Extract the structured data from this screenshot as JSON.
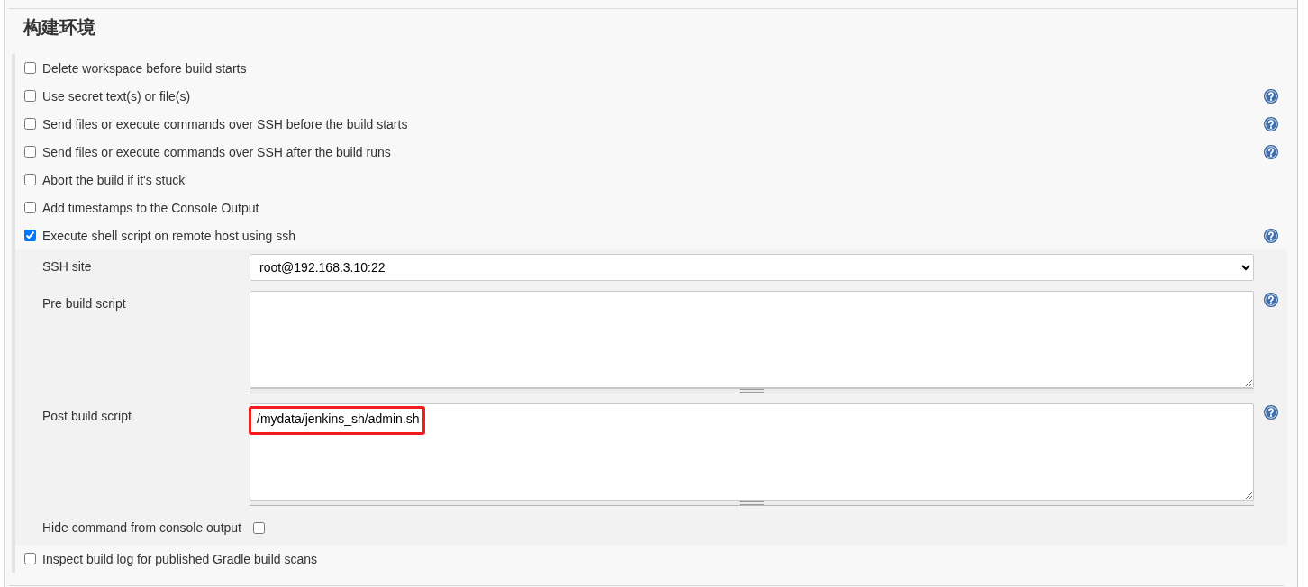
{
  "section": {
    "title": "构建环境"
  },
  "options": [
    {
      "label": "Delete workspace before build starts",
      "checked": false,
      "help": false
    },
    {
      "label": "Use secret text(s) or file(s)",
      "checked": false,
      "help": true
    },
    {
      "label": "Send files or execute commands over SSH before the build starts",
      "checked": false,
      "help": true
    },
    {
      "label": "Send files or execute commands over SSH after the build runs",
      "checked": false,
      "help": true
    },
    {
      "label": "Abort the build if it's stuck",
      "checked": false,
      "help": false
    },
    {
      "label": "Add timestamps to the Console Output",
      "checked": false,
      "help": false
    },
    {
      "label": "Execute shell script on remote host using ssh",
      "checked": true,
      "help": true,
      "details": {
        "fields": [
          {
            "kind": "select",
            "label": "SSH site",
            "value": "root@192.168.3.10:22",
            "help": false
          },
          {
            "kind": "textarea",
            "label": "Pre build script",
            "help": true,
            "highlighted": false
          },
          {
            "kind": "textarea",
            "label": "Post build script",
            "value": "/mydata/jenkins_sh/admin.sh",
            "help": true,
            "highlighted": true
          }
        ],
        "hide_command": {
          "label": "Hide command from console output",
          "checked": false
        }
      }
    },
    {
      "label": "Inspect build log for published Gradle build scans",
      "checked": false,
      "help": false
    }
  ]
}
